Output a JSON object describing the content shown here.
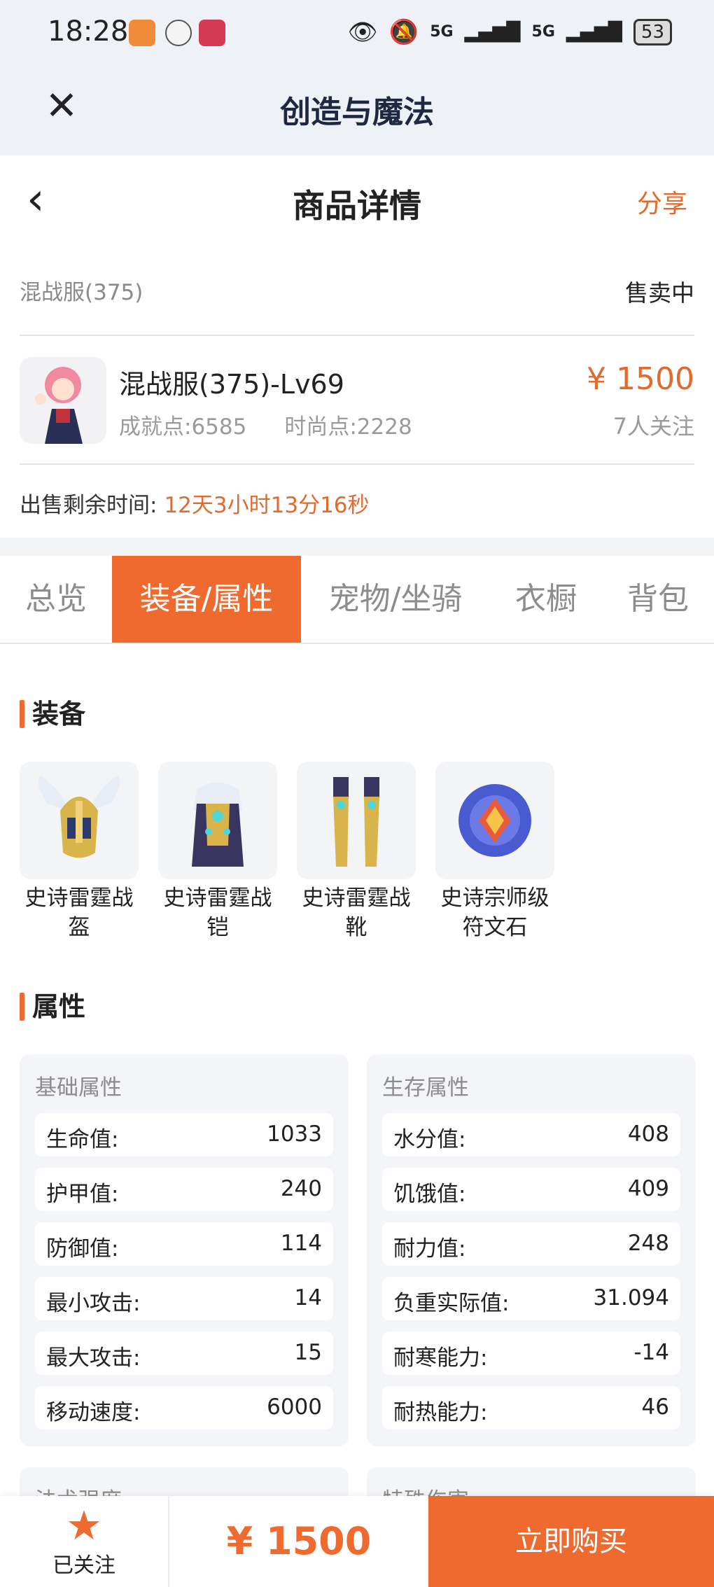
{
  "status_bar": {
    "time": "18:28",
    "network1": "5G",
    "network2": "5G",
    "battery": "53"
  },
  "app_bar": {
    "title": "创造与魔法"
  },
  "header": {
    "title": "商品详情",
    "share": "分享"
  },
  "listing": {
    "server": "混战服(375)",
    "status": "售卖中",
    "name": "混战服(375)-Lv69",
    "achievement": "成就点:6585",
    "fashion": "时尚点:2228",
    "price": "¥ 1500",
    "watchers": "7人关注",
    "remaining_label": "出售剩余时间:",
    "remaining_value": "12天3小时13分16秒"
  },
  "tabs": [
    {
      "label": "总览",
      "active": false
    },
    {
      "label": "装备/属性",
      "active": true
    },
    {
      "label": "宠物/坐骑",
      "active": false
    },
    {
      "label": "衣橱",
      "active": false
    },
    {
      "label": "背包",
      "active": false
    }
  ],
  "equipment": {
    "title": "装备",
    "items": [
      {
        "name": "史诗雷霆战盔"
      },
      {
        "name": "史诗雷霆战铠"
      },
      {
        "name": "史诗雷霆战靴"
      },
      {
        "name": "史诗宗师级符文石"
      }
    ]
  },
  "attributes": {
    "title": "属性",
    "basic": {
      "title": "基础属性",
      "rows": [
        {
          "label": "生命值:",
          "value": "1033"
        },
        {
          "label": "护甲值:",
          "value": "240"
        },
        {
          "label": "防御值:",
          "value": "114"
        },
        {
          "label": "最小攻击:",
          "value": "14"
        },
        {
          "label": "最大攻击:",
          "value": "15"
        },
        {
          "label": "移动速度:",
          "value": "6000"
        }
      ]
    },
    "survival": {
      "title": "生存属性",
      "rows": [
        {
          "label": "水分值:",
          "value": "408"
        },
        {
          "label": "饥饿值:",
          "value": "409"
        },
        {
          "label": "耐力值:",
          "value": "248"
        },
        {
          "label": "负重实际值:",
          "value": "31.094"
        },
        {
          "label": "耐寒能力:",
          "value": "-14"
        },
        {
          "label": "耐热能力:",
          "value": "46"
        }
      ]
    },
    "peek_left": "法术强度",
    "peek_right": "特殊伤害"
  },
  "bottom_bar": {
    "follow": "已关注",
    "price": "¥ 1500",
    "buy": "立即购买"
  },
  "colors": {
    "accent": "#ef6a2f",
    "price": "#e36a2c",
    "title": "#1f2840"
  }
}
